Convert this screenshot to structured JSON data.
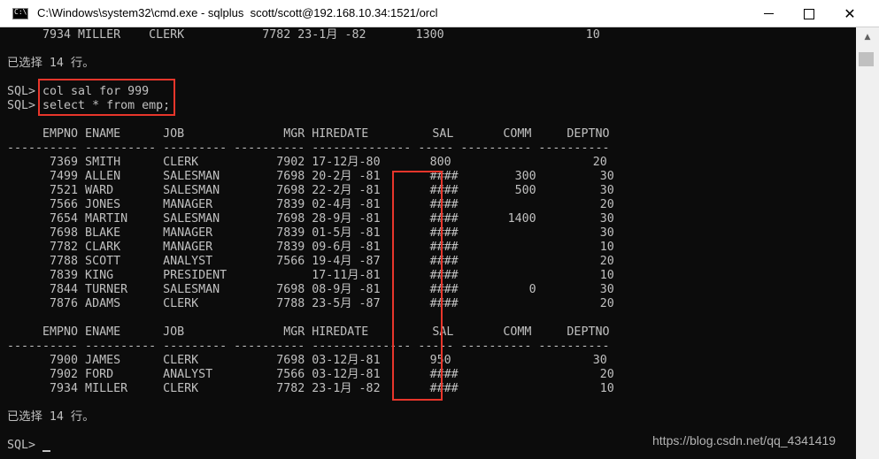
{
  "window": {
    "title": "C:\\Windows\\system32\\cmd.exe - sqlplus  scott/scott@192.168.10.34:1521/orcl",
    "minimize_symbol": "",
    "close_symbol": "✕"
  },
  "console": {
    "lines": [
      "     7934 MILLER    CLERK           7782 23-1月 -82       1300                    10",
      "",
      "已选择 14 行。",
      "",
      "SQL> col sal for 999",
      "SQL> select * from emp;",
      "",
      "     EMPNO ENAME      JOB              MGR HIREDATE         SAL       COMM     DEPTNO",
      "---------- ---------- --------- ---------- -------------- ----- ---------- ----------",
      "      7369 SMITH      CLERK           7902 17-12月-80       800                    20",
      "      7499 ALLEN      SALESMAN        7698 20-2月 -81       ####        300         30",
      "      7521 WARD       SALESMAN        7698 22-2月 -81       ####        500         30",
      "      7566 JONES      MANAGER         7839 02-4月 -81       ####                    20",
      "      7654 MARTIN     SALESMAN        7698 28-9月 -81       ####       1400         30",
      "      7698 BLAKE      MANAGER         7839 01-5月 -81       ####                    30",
      "      7782 CLARK      MANAGER         7839 09-6月 -81       ####                    10",
      "      7788 SCOTT      ANALYST         7566 19-4月 -87       ####                    20",
      "      7839 KING       PRESIDENT            17-11月-81       ####                    10",
      "      7844 TURNER     SALESMAN        7698 08-9月 -81       ####          0         30",
      "      7876 ADAMS      CLERK           7788 23-5月 -87       ####                    20",
      "",
      "     EMPNO ENAME      JOB              MGR HIREDATE         SAL       COMM     DEPTNO",
      "---------- ---------- --------- ---------- -------------- ----- ---------- ----------",
      "      7900 JAMES      CLERK           7698 03-12月-81       950                    30",
      "      7902 FORD       ANALYST         7566 03-12月-81       ####                    20",
      "      7934 MILLER     CLERK           7782 23-1月 -82       ####                    10",
      "",
      "已选择 14 行。",
      "",
      "SQL> "
    ]
  },
  "watermark": "https://blog.csdn.net/qq_4341419"
}
